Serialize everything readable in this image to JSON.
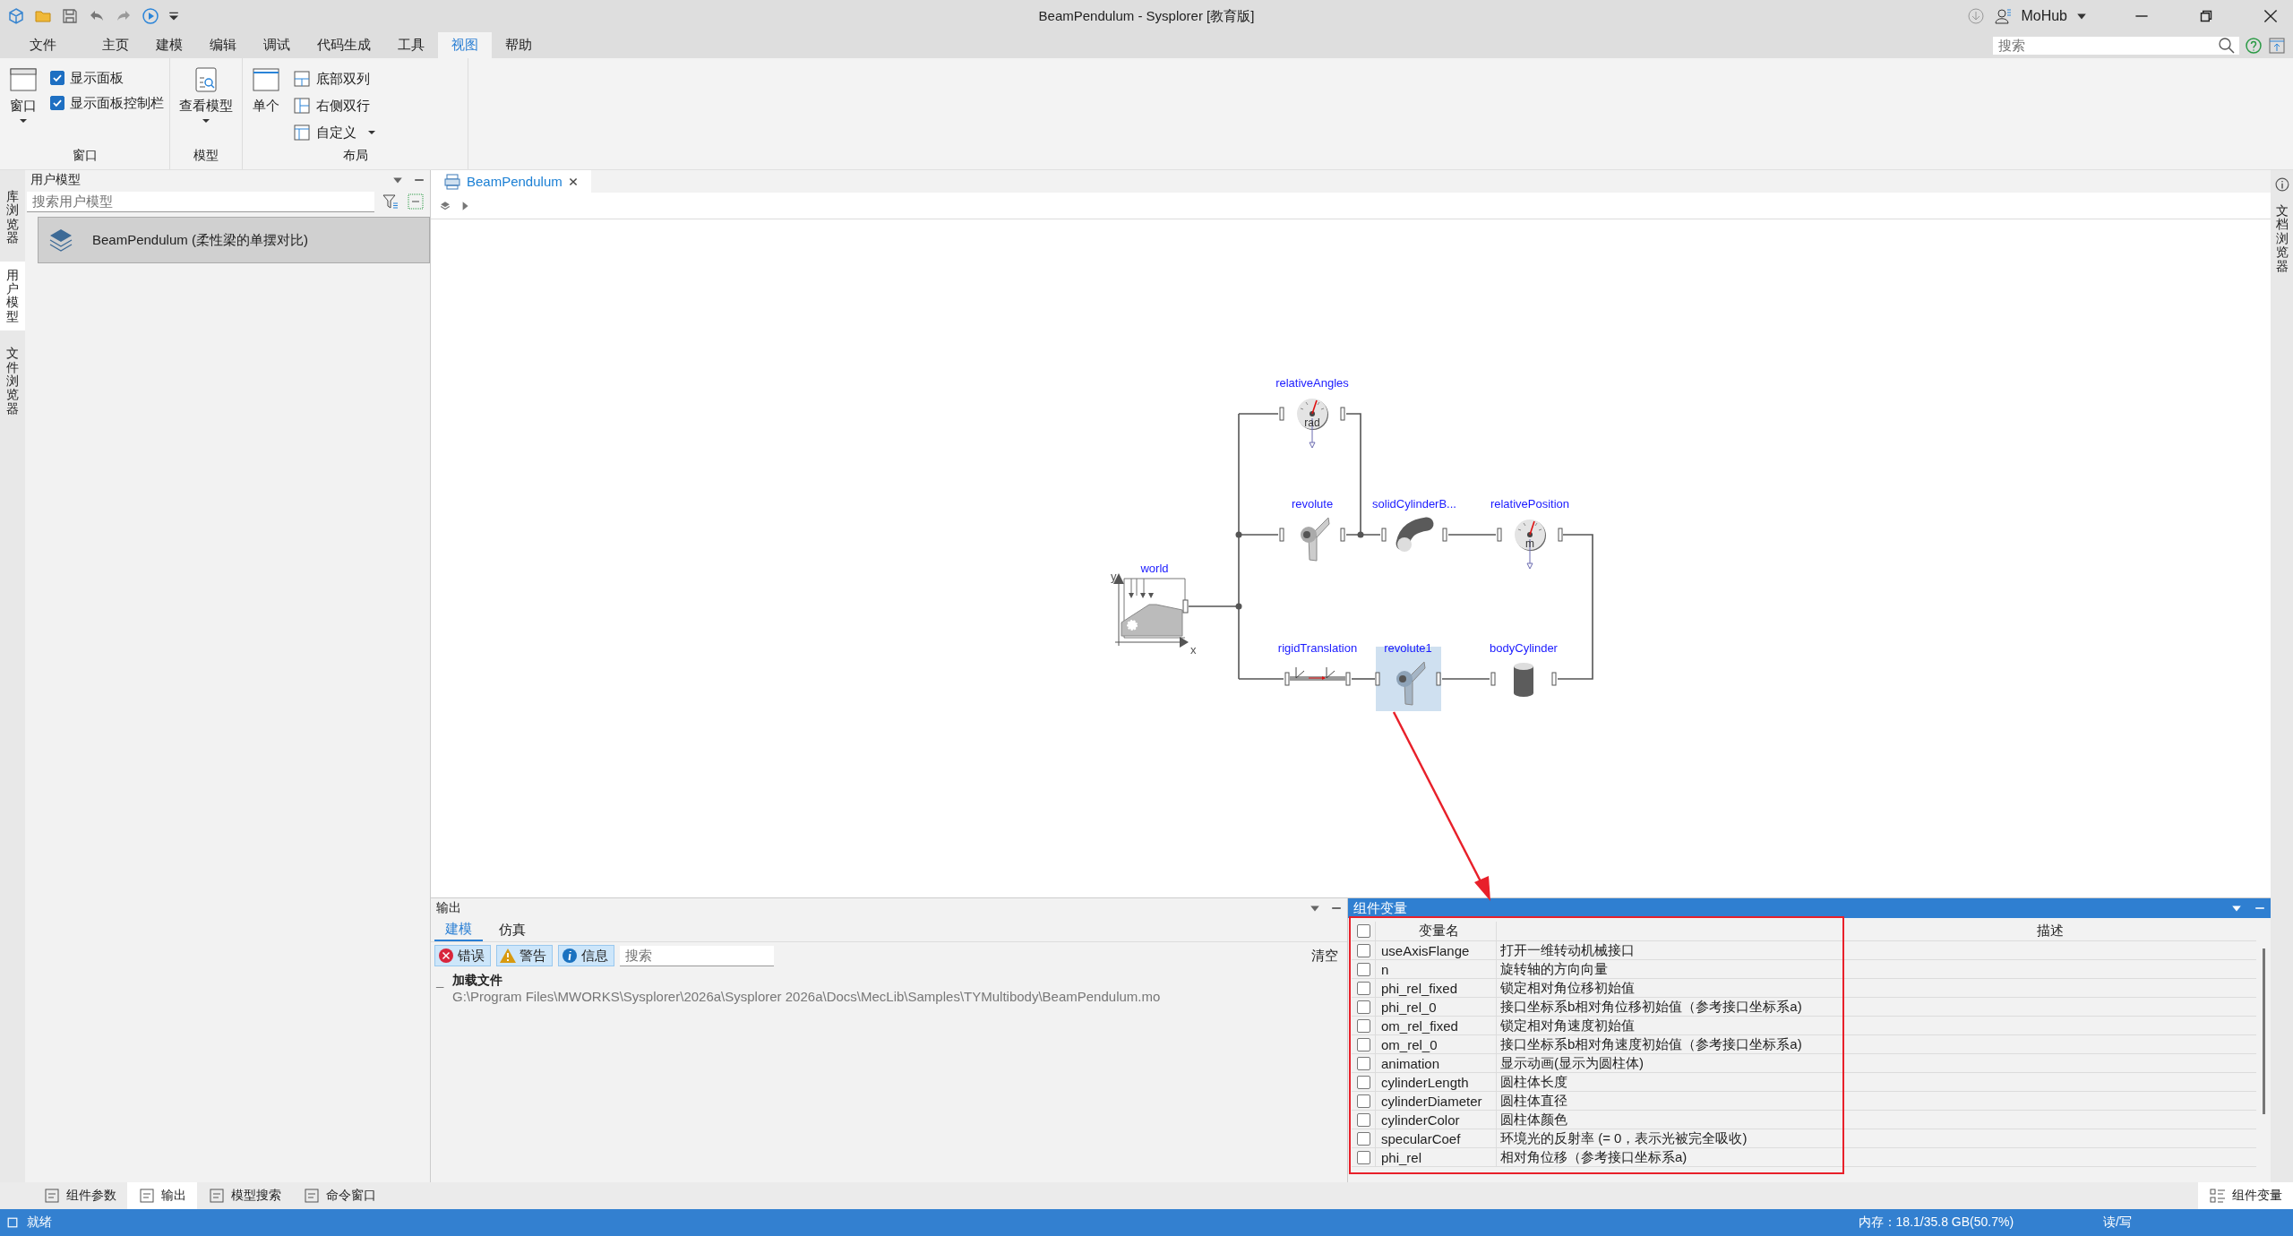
{
  "window": {
    "title": "BeamPendulum - Sysplorer [教育版]",
    "account": "MoHub"
  },
  "search": {
    "placeholder": "搜索"
  },
  "menu": [
    {
      "label": "文件",
      "selected": false
    },
    {
      "label": "主页",
      "selected": false
    },
    {
      "label": "建模",
      "selected": false
    },
    {
      "label": "编辑",
      "selected": false
    },
    {
      "label": "调试",
      "selected": false
    },
    {
      "label": "代码生成",
      "selected": false
    },
    {
      "label": "工具",
      "selected": false
    },
    {
      "label": "视图",
      "selected": true
    },
    {
      "label": "帮助",
      "selected": false
    }
  ],
  "ribbon": {
    "groups": [
      {
        "title": "窗口",
        "items": [
          {
            "kind": "large",
            "label": "窗口",
            "dropdown": true
          },
          {
            "kind": "checkbox",
            "label": "显示面板",
            "checked": true
          },
          {
            "kind": "checkbox",
            "label": "显示面板控制栏",
            "checked": true
          }
        ]
      },
      {
        "title": "模型",
        "items": [
          {
            "kind": "large",
            "label": "查看模型",
            "dropdown": true
          }
        ]
      },
      {
        "title": "布局",
        "items": [
          {
            "kind": "large",
            "label": "单个",
            "dropdown": false
          },
          {
            "kind": "small",
            "label": "底部双列",
            "dropdown": false
          },
          {
            "kind": "small",
            "label": "右侧双行",
            "dropdown": false
          },
          {
            "kind": "small",
            "label": "自定义",
            "dropdown": true
          }
        ]
      }
    ]
  },
  "side_tabs": [
    {
      "label": "库浏览器",
      "selected": false
    },
    {
      "label": "用户模型",
      "selected": true
    },
    {
      "label": "文件浏览器",
      "selected": false
    }
  ],
  "right_tabs": [
    {
      "label": "文档浏览器",
      "selected": false
    }
  ],
  "model_panel": {
    "title": "用户模型",
    "search_placeholder": "搜索用户模型",
    "items": [
      {
        "label": "BeamPendulum (柔性梁的单摆对比)",
        "selected": true
      }
    ]
  },
  "editor": {
    "tabs": [
      {
        "label": "BeamPendulum",
        "selected": true
      }
    ],
    "diagram": {
      "axis_labels": {
        "x": "x",
        "y": "y"
      },
      "components": [
        {
          "label": "relativeAngles",
          "kind": "gauge",
          "unit": "rad",
          "selected": false
        },
        {
          "label": "revolute",
          "kind": "revolute",
          "selected": false
        },
        {
          "label": "solidCylinderB...",
          "kind": "bent_cylinder",
          "selected": false
        },
        {
          "label": "relativePosition",
          "kind": "gauge",
          "unit": "m",
          "selected": false
        },
        {
          "label": "world",
          "kind": "world",
          "selected": false
        },
        {
          "label": "rigidTranslation",
          "kind": "translation",
          "selected": false
        },
        {
          "label": "revolute1",
          "kind": "revolute",
          "selected": true
        },
        {
          "label": "bodyCylinder",
          "kind": "cylinder",
          "selected": false
        }
      ]
    }
  },
  "output": {
    "title": "输出",
    "tabs": [
      {
        "label": "建模",
        "selected": true
      },
      {
        "label": "仿真",
        "selected": false
      }
    ],
    "filters": [
      {
        "label": "错误",
        "kind": "error",
        "on": true
      },
      {
        "label": "警告",
        "kind": "warning",
        "on": true
      },
      {
        "label": "信息",
        "kind": "info",
        "on": true
      }
    ],
    "search_placeholder": "搜索",
    "clear": "清空",
    "log": [
      {
        "marker": "_",
        "label": "加载文件",
        "expanded": true,
        "children": [
          {
            "label": "G:\\Program Files\\MWORKS\\Sysplorer\\2026a\\Sysplorer 2026a\\Docs\\MecLib\\Samples\\TYMultibody\\BeamPendulum.mo"
          }
        ]
      }
    ]
  },
  "variables": {
    "title": "组件变量",
    "header_name": "变量名",
    "header_description": "描述",
    "all_checked": false,
    "rows": [
      {
        "name": "useAxisFlange",
        "column_3": "打开一维转动机械接口",
        "checked": false
      },
      {
        "name": "n",
        "column_3": "旋转轴的方向向量",
        "checked": false
      },
      {
        "name": "phi_rel_fixed",
        "column_3": "锁定相对角位移初始值",
        "checked": false
      },
      {
        "name": "phi_rel_0",
        "column_3": "接口坐标系b相对角位移初始值（参考接口坐标系a)",
        "checked": false
      },
      {
        "name": "om_rel_fixed",
        "column_3": "锁定相对角速度初始值",
        "checked": false
      },
      {
        "name": "om_rel_0",
        "column_3": "接口坐标系b相对角速度初始值（参考接口坐标系a)",
        "checked": false
      },
      {
        "name": "animation",
        "column_3": "显示动画(显示为圆柱体)",
        "checked": false
      },
      {
        "name": "cylinderLength",
        "column_3": "圆柱体长度",
        "checked": false
      },
      {
        "name": "cylinderDiameter",
        "column_3": "圆柱体直径",
        "checked": false
      },
      {
        "name": "cylinderColor",
        "column_3": "圆柱体颜色",
        "checked": false
      },
      {
        "name": "specularCoef",
        "column_3": "环境光的反射率 (= 0，表示光被完全吸收)",
        "checked": false
      },
      {
        "name": "phi_rel",
        "column_3": "相对角位移（参考接口坐标系a)",
        "checked": false
      }
    ]
  },
  "bottom_tabs": {
    "left": [
      {
        "label": "组件参数",
        "selected": false
      },
      {
        "label": "输出",
        "selected": true
      },
      {
        "label": "模型搜索",
        "selected": false
      },
      {
        "label": "命令窗口",
        "selected": false
      }
    ],
    "right": [
      {
        "label": "组件变量",
        "selected": true
      }
    ]
  },
  "status_bar": {
    "text": "就绪",
    "memory": "内存：18.1/35.8 GB(50.7%)",
    "mode": "读/写"
  }
}
